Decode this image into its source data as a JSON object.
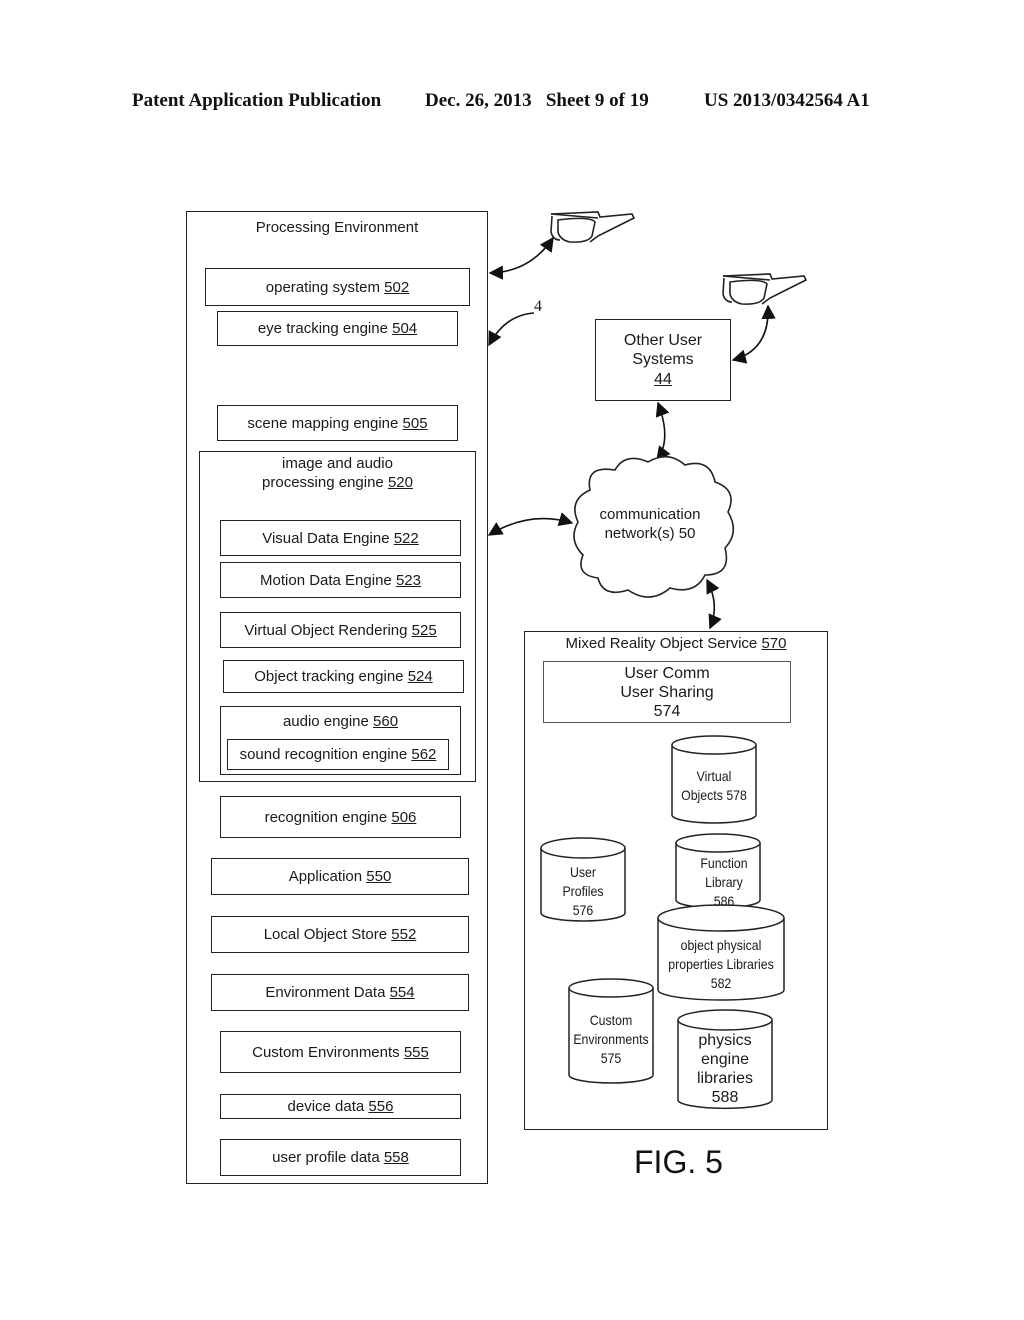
{
  "header": {
    "publication": "Patent Application Publication",
    "date_sheet": "Dec. 26, 2013   Sheet 9 of 19",
    "patent_number": "US 2013/0342564 A1"
  },
  "processing_environment": {
    "title": "Processing Environment",
    "modules": [
      {
        "text": "operating system ",
        "num": "502"
      },
      {
        "text": "eye tracking engine ",
        "num": "504"
      },
      {
        "text": "scene mapping engine ",
        "num": "505"
      }
    ],
    "image_audio_engine": {
      "title_line1": "image and audio",
      "title_line2": "processing engine ",
      "num": "520",
      "sub": [
        {
          "text": "Visual Data Engine ",
          "num": "522"
        },
        {
          "text": "Motion Data Engine ",
          "num": "523"
        },
        {
          "text": "Virtual Object Rendering ",
          "num": "525"
        },
        {
          "text": "Object tracking engine ",
          "num": "524"
        }
      ],
      "audio": {
        "text": "audio engine ",
        "num": "560",
        "sub_text": "sound recognition engine ",
        "sub_num": "562"
      }
    },
    "lower_modules": [
      {
        "text": "recognition engine ",
        "num": "506"
      },
      {
        "text": "Application ",
        "num": "550"
      },
      {
        "text": "Local Object Store ",
        "num": "552"
      },
      {
        "text": "Environment Data ",
        "num": "554"
      },
      {
        "text": "Custom Environments ",
        "num": "555"
      },
      {
        "text": "device data ",
        "num": "556"
      },
      {
        "text": "user profile data ",
        "num": "558"
      }
    ]
  },
  "ref_label": "4",
  "other_user_systems": {
    "line1": "Other User",
    "line2": "Systems",
    "num": "44"
  },
  "network": {
    "line1": "communication",
    "line2": "network(s) 50"
  },
  "mixed_reality_service": {
    "title": "Mixed Reality Object Service ",
    "num": "570",
    "user_comm": {
      "line1": "User Comm",
      "line2": "User Sharing",
      "line3": "574"
    },
    "databases": [
      {
        "id": "virtual-objects",
        "lines": [
          "Virtual",
          "Objects 578"
        ]
      },
      {
        "id": "user-profiles",
        "lines": [
          "User",
          "Profiles",
          "576"
        ]
      },
      {
        "id": "function-library",
        "lines": [
          "Function",
          "Library",
          "586"
        ]
      },
      {
        "id": "object-physical-properties",
        "lines": [
          "object physical",
          "properties Libraries",
          "582"
        ]
      },
      {
        "id": "custom-environments",
        "lines": [
          "Custom",
          "Environments",
          "575"
        ]
      },
      {
        "id": "physics-engine-libraries",
        "lines": [
          "physics",
          "engine",
          "libraries",
          "588"
        ]
      }
    ]
  },
  "figure_label": "FIG. 5"
}
